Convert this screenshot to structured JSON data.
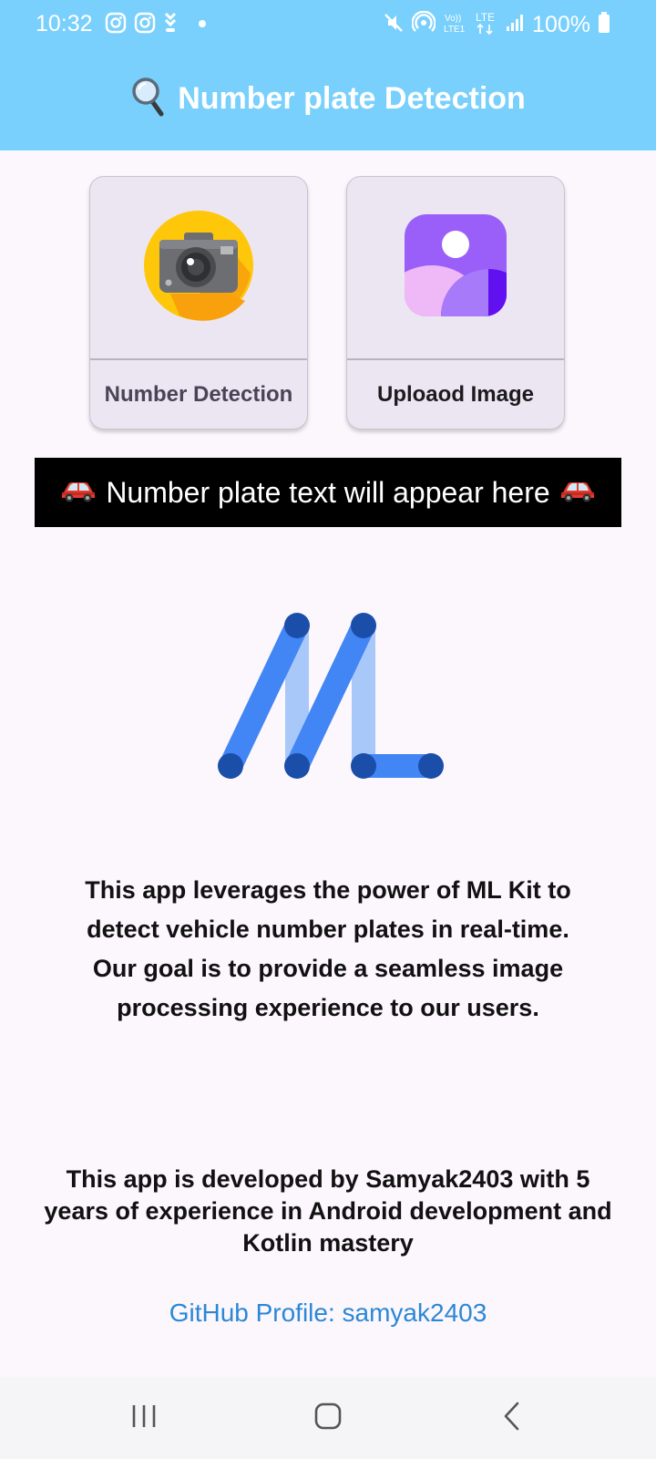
{
  "status_bar": {
    "time": "10:32",
    "battery_percent": "100%",
    "network_label": "LTE",
    "left_icons": [
      "instagram-icon",
      "instagram-icon",
      "download-icon",
      "dot-icon"
    ],
    "right_icons": [
      "mute-icon",
      "hotspot-icon",
      "volte-icon",
      "lte-icon",
      "signal-icon",
      "battery-icon"
    ]
  },
  "header": {
    "title": "Number plate Detection",
    "icon": "magnifier-icon",
    "background_color": "#79d0fc"
  },
  "actions": {
    "camera": {
      "label": "Number Detection",
      "icon": "camera-icon"
    },
    "upload": {
      "label": "Uploaod Image",
      "icon": "gallery-icon"
    }
  },
  "result": {
    "placeholder": "Number plate text will appear here",
    "emoji": "🚗"
  },
  "logo": {
    "name": "ml-kit-logo"
  },
  "about": {
    "text": "This app leverages the power of ML Kit to detect vehicle number plates in real-time.\nOur goal is to provide a seamless image processing experience to our users."
  },
  "developer": {
    "text": "This app is developed by Samyak2403 with 5 years of experience in Android development and Kotlin mastery"
  },
  "github": {
    "label": "GitHub Profile: samyak2403",
    "color": "#2a88d6"
  },
  "nav_bar": {
    "items": [
      "recents-icon",
      "home-icon",
      "back-icon"
    ]
  }
}
